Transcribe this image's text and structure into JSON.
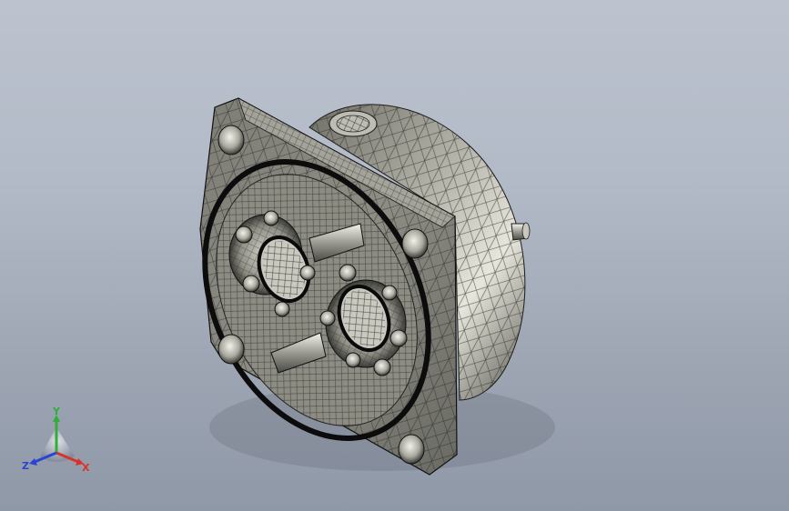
{
  "viewport": {
    "model": "gear-pump-assembly",
    "background_top": "#bcc3cf",
    "background_bottom": "#8f98a7",
    "body_color": "#8a8a80",
    "edge_color": "#1a1a1a"
  },
  "triad": {
    "x_label": "X",
    "y_label": "Y",
    "z_label": "Z",
    "x_color": "#d8332b",
    "y_color": "#2fae3a",
    "z_color": "#2a45d0"
  }
}
